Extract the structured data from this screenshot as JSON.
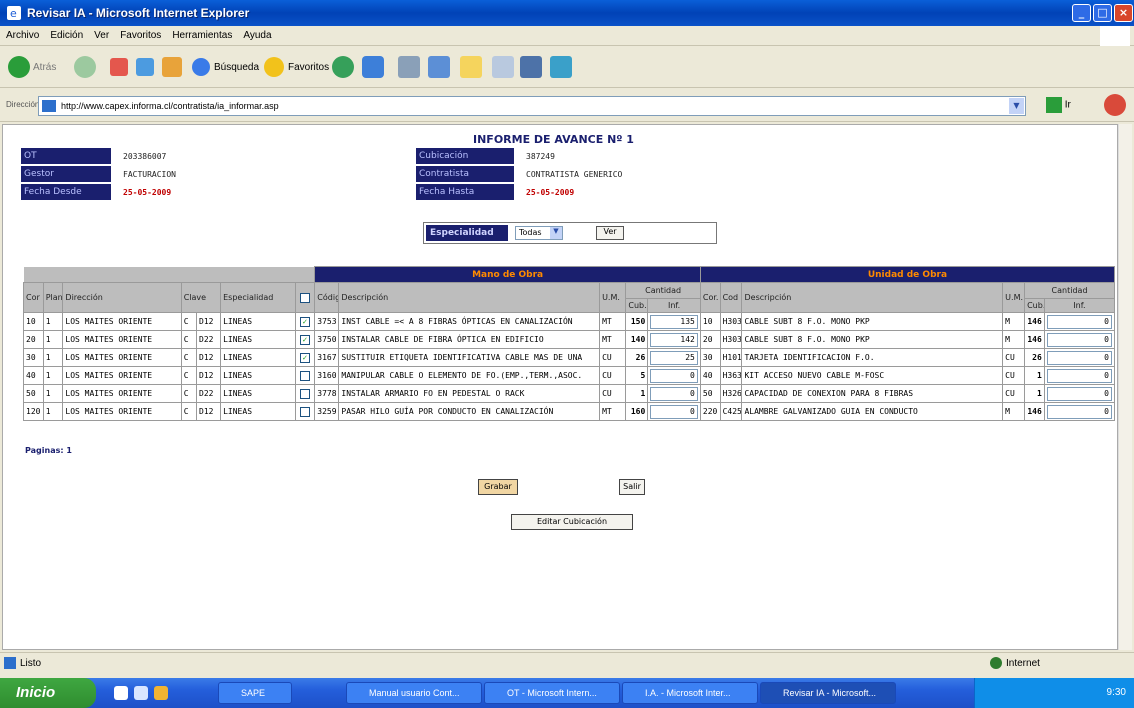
{
  "window": {
    "title": "Revisar IA - Microsoft Internet Explorer"
  },
  "menu": [
    "Archivo",
    "Edición",
    "Ver",
    "Favoritos",
    "Herramientas",
    "Ayuda"
  ],
  "toolbar": {
    "back": "Atrás",
    "search": "Búsqueda",
    "favorites": "Favoritos"
  },
  "address": {
    "label": "Dirección",
    "url": "http://www.capex.informa.cl/contratista/ia_informar.asp",
    "go": "Ir"
  },
  "report": {
    "title": "INFORME DE AVANCE Nº 1",
    "ot_label": "OT",
    "ot_value": "203386007",
    "gestor_label": "Gestor",
    "gestor_value": "FACTURACION",
    "fecha_desde_label": "Fecha Desde",
    "fecha_desde_value": "25-05-2009",
    "cubicacion_label": "Cubicación",
    "cubicacion_value": "387249",
    "contratista_label": "Contratista",
    "contratista_value": "CONTRATISTA GENERICO",
    "fecha_hasta_label": "Fecha Hasta",
    "fecha_hasta_value": "25-05-2009",
    "especialidad_label": "Especialidad",
    "especialidad_selected": "Todas",
    "ver_button": "Ver"
  },
  "table": {
    "group_mano": "Mano de Obra",
    "group_unidad": "Unidad de Obra",
    "headers": {
      "cor": "Cor",
      "plano": "Plano",
      "direccion": "Dirección",
      "clave": "Clave",
      "especialidad": "Especialidad",
      "codigo": "Código",
      "descripcion": "Descripción",
      "um": "U.M.",
      "cantidad": "Cantidad",
      "cub": "Cub.",
      "inf": "Inf.",
      "cor2": "Cor.",
      "cod": "Cod",
      "descripcion2": "Descripción",
      "um2": "U.M.",
      "cantidad2": "Cantidad",
      "cub2": "Cub.",
      "inf2": "Inf."
    },
    "rows": [
      {
        "cor": "10",
        "plano": "1",
        "dir": "LOS MAITES ORIENTE",
        "clave": "C",
        "clave_code": "D12",
        "esp": "LINEAS",
        "checked": "✓",
        "cod": "3753",
        "desc": "INST CABLE =< A 8 FIBRAS ÓPTICAS EN CANALIZACIÓN",
        "um": "MT",
        "cub": "150",
        "inf": "135",
        "cor2": "10",
        "cod2": "H303",
        "desc2": "CABLE SUBT 8 F.O. MONO PKP",
        "um2": "M",
        "cub2": "146",
        "inf2": "0"
      },
      {
        "cor": "20",
        "plano": "1",
        "dir": "LOS MAITES ORIENTE",
        "clave": "C",
        "clave_code": "D22",
        "esp": "LINEAS",
        "checked": "✓",
        "cod": "3750",
        "desc": "INSTALAR CABLE DE FIBRA ÓPTICA EN EDIFICIO",
        "um": "MT",
        "cub": "140",
        "inf": "142",
        "cor2": "20",
        "cod2": "H303",
        "desc2": "CABLE SUBT 8 F.O. MONO PKP",
        "um2": "M",
        "cub2": "146",
        "inf2": "0"
      },
      {
        "cor": "30",
        "plano": "1",
        "dir": "LOS MAITES ORIENTE",
        "clave": "C",
        "clave_code": "D12",
        "esp": "LINEAS",
        "checked": "✓",
        "cod": "3167",
        "desc": "SUSTITUIR ETIQUETA IDENTIFICATIVA CABLE MAS DE UNA",
        "um": "CU",
        "cub": "26",
        "inf": "25",
        "cor2": "30",
        "cod2": "H101",
        "desc2": "TARJETA IDENTIFICACION F.O.",
        "um2": "CU",
        "cub2": "26",
        "inf2": "0"
      },
      {
        "cor": "40",
        "plano": "1",
        "dir": "LOS MAITES ORIENTE",
        "clave": "C",
        "clave_code": "D12",
        "esp": "LINEAS",
        "checked": "",
        "cod": "3160",
        "desc": "MANIPULAR CABLE O ELEMENTO DE FO.(EMP.,TERM.,ASOC.",
        "um": "CU",
        "cub": "5",
        "inf": "0",
        "cor2": "40",
        "cod2": "H363",
        "desc2": "KIT ACCESO NUEVO CABLE M-FOSC",
        "um2": "CU",
        "cub2": "1",
        "inf2": "0"
      },
      {
        "cor": "50",
        "plano": "1",
        "dir": "LOS MAITES ORIENTE",
        "clave": "C",
        "clave_code": "D22",
        "esp": "LINEAS",
        "checked": "",
        "cod": "3778",
        "desc": "INSTALAR ARMARIO FO EN PEDESTAL O RACK",
        "um": "CU",
        "cub": "1",
        "inf": "0",
        "cor2": "50",
        "cod2": "H326",
        "desc2": "CAPACIDAD DE CONEXION PARA 8 FIBRAS",
        "um2": "CU",
        "cub2": "1",
        "inf2": "0"
      },
      {
        "cor": "120",
        "plano": "1",
        "dir": "LOS MAITES ORIENTE",
        "clave": "C",
        "clave_code": "D12",
        "esp": "LINEAS",
        "checked": "",
        "cod": "3259",
        "desc": "PASAR HILO GUÍA POR CONDUCTO EN CANALIZACIÓN",
        "um": "MT",
        "cub": "160",
        "inf": "0",
        "cor2": "220",
        "cod2": "C425",
        "desc2": "ALAMBRE GALVANIZADO GUIA EN CONDUCTO",
        "um2": "M",
        "cub2": "146",
        "inf2": "0"
      }
    ],
    "paginas_label": "Paginas:",
    "paginas_value": "1"
  },
  "buttons": {
    "grabar": "Grabar",
    "salir": "Salir",
    "editar": "Editar Cubicación"
  },
  "status": {
    "left": "Listo",
    "right": "Internet"
  },
  "taskbar": {
    "start": "Inicio",
    "items": [
      "SAPE",
      "Manual usuario Cont...",
      "OT - Microsoft Intern...",
      "I.A. - Microsoft Inter...",
      "Revisar IA - Microsoft..."
    ],
    "clock": "9:30"
  },
  "colors": {
    "navy": "#1a1f6e",
    "orange": "#ff8a00",
    "red": "#c00000"
  }
}
